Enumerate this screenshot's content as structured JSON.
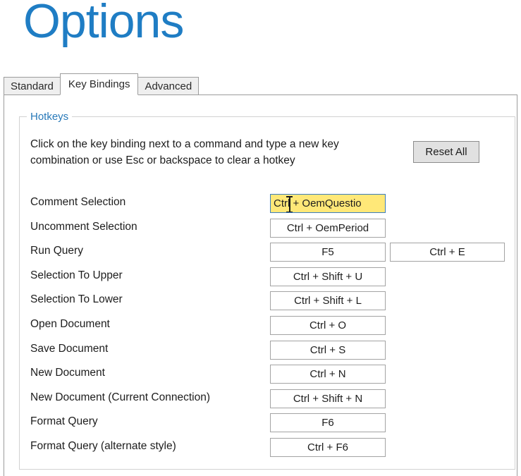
{
  "page_title": "Options",
  "tabs": [
    {
      "label": "Standard",
      "selected": false
    },
    {
      "label": "Key Bindings",
      "selected": true
    },
    {
      "label": "Advanced",
      "selected": false
    }
  ],
  "hotkeys": {
    "legend": "Hotkeys",
    "description": "Click on the key binding next to a command and type a new key combination or use Esc or backspace to clear a hotkey",
    "reset_all_label": "Reset All",
    "bindings": [
      {
        "command": "Comment Selection",
        "primary": "Ctrl + OemQuestio",
        "secondary": "",
        "focused": true
      },
      {
        "command": "Uncomment Selection",
        "primary": "Ctrl + OemPeriod",
        "secondary": "",
        "focused": false
      },
      {
        "command": "Run Query",
        "primary": "F5",
        "secondary": "Ctrl + E",
        "focused": false
      },
      {
        "command": "Selection To Upper",
        "primary": "Ctrl + Shift + U",
        "secondary": "",
        "focused": false
      },
      {
        "command": "Selection To Lower",
        "primary": "Ctrl + Shift + L",
        "secondary": "",
        "focused": false
      },
      {
        "command": "Open Document",
        "primary": "Ctrl + O",
        "secondary": "",
        "focused": false
      },
      {
        "command": "Save Document",
        "primary": "Ctrl + S",
        "secondary": "",
        "focused": false
      },
      {
        "command": "New Document",
        "primary": "Ctrl + N",
        "secondary": "",
        "focused": false
      },
      {
        "command": "New Document (Current Connection)",
        "primary": "Ctrl + Shift + N",
        "secondary": "",
        "focused": false
      },
      {
        "command": "Format Query",
        "primary": "F6",
        "secondary": "",
        "focused": false
      },
      {
        "command": "Format Query (alternate style)",
        "primary": "Ctrl + F6",
        "secondary": "",
        "focused": false
      }
    ]
  },
  "colors": {
    "title_blue": "#1f7dc4",
    "legend_blue": "#2879b9",
    "focus_highlight": "#ffe878",
    "focus_border": "#3b7cbd",
    "field_border": "#a3a3a3",
    "button_face": "#e1e1e1"
  }
}
